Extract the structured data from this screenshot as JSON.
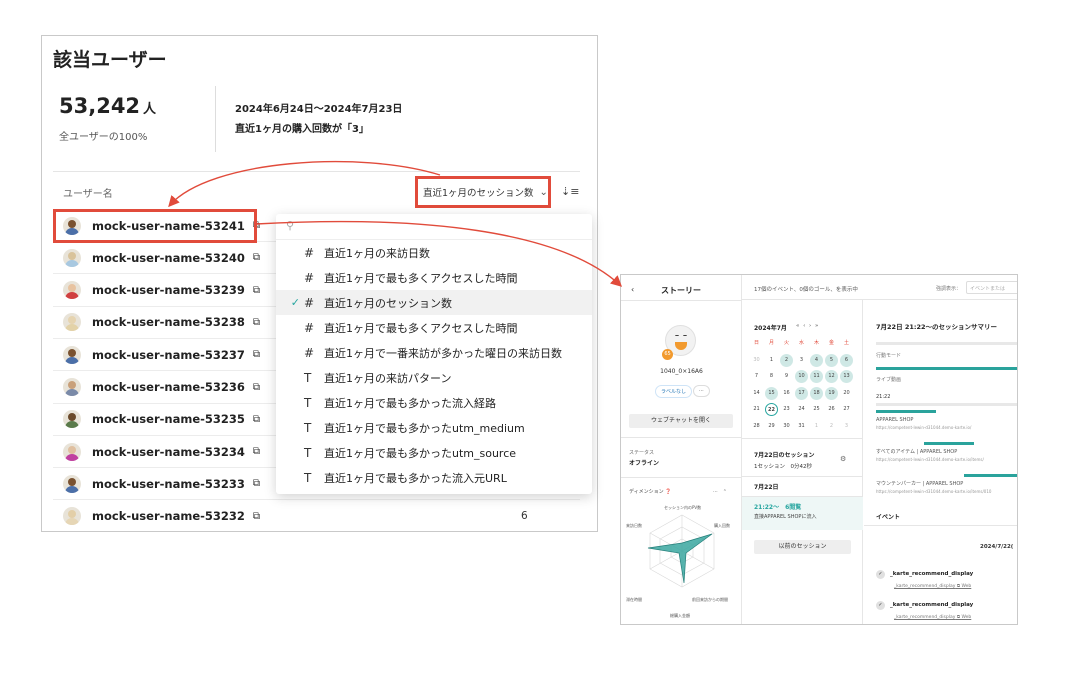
{
  "main": {
    "title": "該当ユーザー",
    "count": "53,242",
    "count_unit": "人",
    "count_sub": "全ユーザーの100%",
    "cond_date": "2024年6月24日〜2024年7月23日",
    "cond_text": "直近1ヶ月の購入回数が「3」",
    "col_user": "ユーザー名",
    "sort_label": "直近1ヶ月のセッション数",
    "users": [
      {
        "name": "mock-user-name-53241",
        "value": ""
      },
      {
        "name": "mock-user-name-53240",
        "value": ""
      },
      {
        "name": "mock-user-name-53239",
        "value": ""
      },
      {
        "name": "mock-user-name-53238",
        "value": ""
      },
      {
        "name": "mock-user-name-53237",
        "value": ""
      },
      {
        "name": "mock-user-name-53236",
        "value": ""
      },
      {
        "name": "mock-user-name-53235",
        "value": ""
      },
      {
        "name": "mock-user-name-53234",
        "value": ""
      },
      {
        "name": "mock-user-name-53233",
        "value": ""
      },
      {
        "name": "mock-user-name-53232",
        "value": "6"
      }
    ]
  },
  "menu": {
    "items": [
      {
        "type": "#",
        "label": "直近1ヶ月の来訪日数",
        "selected": false
      },
      {
        "type": "#",
        "label": "直近1ヶ月で最も多くアクセスした時間",
        "selected": false
      },
      {
        "type": "#",
        "label": "直近1ヶ月のセッション数",
        "selected": true
      },
      {
        "type": "#",
        "label": "直近1ヶ月で最も多くアクセスした時間",
        "selected": false
      },
      {
        "type": "#",
        "label": "直近1ヶ月で一番来訪が多かった曜日の来訪日数",
        "selected": false
      },
      {
        "type": "T",
        "label": "直近1ヶ月の来訪パターン",
        "selected": false
      },
      {
        "type": "T",
        "label": "直近1ヶ月で最も多かった流入経路",
        "selected": false
      },
      {
        "type": "T",
        "label": "直近1ヶ月で最も多かったutm_medium",
        "selected": false
      },
      {
        "type": "T",
        "label": "直近1ヶ月で最も多かったutm_source",
        "selected": false
      },
      {
        "type": "T",
        "label": "直近1ヶ月で最も多かった流入元URL",
        "selected": false
      }
    ]
  },
  "story": {
    "back": "‹",
    "title": "ストーリー",
    "topbar_info": "17個のイベント、0個のゴール、を表示中",
    "display_label": "強調表示：",
    "search_placeholder": "イベントまたは",
    "user_id": "1040_0×16A6",
    "badge": "65",
    "label_none": "ラベルなし",
    "more": "···",
    "webchat": "ウェブチャットを開く",
    "status_label": "ステータス",
    "status_value": "オフライン",
    "dimension_label": "ディメンション",
    "radar_labels": [
      "セッション内のPV数",
      "購入回数",
      "前回来訪からの期間",
      "総購入金額",
      "滞在時間",
      "来訪日数"
    ],
    "calendar": {
      "month": "2024年7月",
      "nav": "« ‹ › »",
      "dow": [
        "日",
        "月",
        "火",
        "水",
        "木",
        "金",
        "土"
      ],
      "weeks": [
        [
          "30",
          "1",
          "2",
          "3",
          "4",
          "5",
          "6"
        ],
        [
          "7",
          "8",
          "9",
          "10",
          "11",
          "12",
          "13"
        ],
        [
          "14",
          "15",
          "16",
          "17",
          "18",
          "19",
          "20"
        ],
        [
          "21",
          "22",
          "23",
          "24",
          "25",
          "26",
          "27"
        ],
        [
          "28",
          "29",
          "30",
          "31",
          "1",
          "2",
          "3"
        ]
      ]
    },
    "session_title": "7月22日のセッション",
    "session_value": "1セッション　0分42秒",
    "date2": "7月22日",
    "session_time": "21:22〜　6閲覧",
    "session_desc": "直接APPAREL SHOPに流入",
    "prev_sessions": "以前のセッション",
    "summary_title": "7月22日 21:22〜のセッションサマリー",
    "action_mode": "行動モード",
    "live": "ライブ動画",
    "time_mark": "21:22",
    "pages": [
      {
        "title": "APPAREL SHOP",
        "url": "https://competent-lewin-d31044.demo-karte.io/"
      },
      {
        "title": "すべてのアイテム | APPAREL SHOP",
        "url": "https://competent-lewin-d31044.demo-karte.io/items/"
      },
      {
        "title": "マウンテンパーカー | APPAREL SHOP",
        "url": "https://competent-lewin-d31044.demo-karte.io/items/010"
      }
    ],
    "event_header": "イベント",
    "event_date": "2024/7/22(",
    "events": [
      {
        "name": "_karte_recommend_display",
        "sub": "_karte_recommend_display",
        "tag": "Web"
      },
      {
        "name": "_karte_recommend_display",
        "sub": "_karte_recommend_display",
        "tag": "Web"
      }
    ]
  },
  "colors": {
    "accent": "#27a6a0",
    "highlight": "#e14b3b",
    "teal_bar": "#2aa39c"
  }
}
